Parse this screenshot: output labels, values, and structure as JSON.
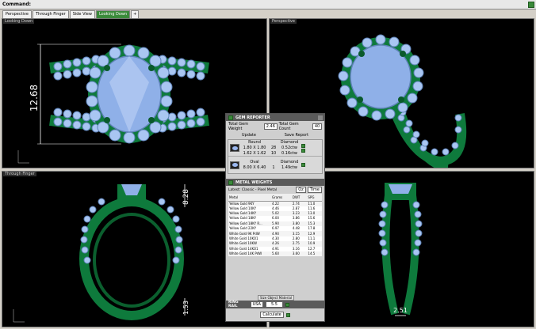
{
  "command": {
    "label": "Command:"
  },
  "tabs": [
    "Perspective",
    "Through Finger",
    "Side View",
    "Looking Down",
    "+"
  ],
  "viewports": {
    "top_left": {
      "caption": "Looking Down",
      "dimension": "12.68"
    },
    "top_right": {
      "caption": "Perspective"
    },
    "bottom_left": {
      "caption": "Through Finger",
      "dim_top": "8.28",
      "dim_bottom": "1.53"
    },
    "bottom_right": {
      "caption": "",
      "dimension": "2.51"
    }
  },
  "gem_reporter": {
    "title": "GEM REPORTER",
    "total_weight_label": "Total Gem Weight",
    "total_weight_value": "2.46",
    "total_count_label": "Total Gem Count",
    "total_count_value": "40",
    "update_label": "Update",
    "save_label": "Save Report",
    "gems": [
      {
        "shape": "Round",
        "type": "Diamond",
        "sizes": [
          "1.80 X 1.80",
          "1.62 X 1.62"
        ],
        "counts": [
          "28",
          "10"
        ],
        "weights": [
          "0.52ctw",
          "0.16ctw"
        ]
      },
      {
        "shape": "Oval",
        "type": "Diamond",
        "sizes": [
          "8.00 X 6.40"
        ],
        "counts": [
          "1"
        ],
        "weights": [
          "1.49ctw"
        ]
      }
    ]
  },
  "metal_weights": {
    "title": "METAL WEIGHTS",
    "subtitle": "Latest: Classic - Pixel Metal",
    "unit_select": "Oz",
    "extra_select": "Time",
    "columns": [
      "Metal",
      "Grams",
      "DWT",
      "SPG"
    ],
    "rows": [
      [
        "Yellow Gold 9KY",
        "4.22",
        "2.74",
        "11.0"
      ],
      [
        "Yellow Gold 10KY",
        "4.46",
        "2.87",
        "11.6"
      ],
      [
        "Yellow Gold 14KY",
        "5.02",
        "3.23",
        "13.0"
      ],
      [
        "Yellow Gold 18KY",
        "6.00",
        "3.86",
        "15.6"
      ],
      [
        "Yellow Gold 18KY R...",
        "5.90",
        "3.80",
        "15.3"
      ],
      [
        "Yellow Gold 22KY",
        "6.97",
        "4.48",
        "17.8"
      ],
      [
        "White Gold 9K PdW",
        "4.90",
        "3.15",
        "12.9"
      ],
      [
        "White Gold 10KO1",
        "4.30",
        "2.80",
        "11.1"
      ],
      [
        "White Gold 10KW",
        "4.26",
        "2.75",
        "10.9"
      ],
      [
        "White Gold 14KO1",
        "4.91",
        "3.16",
        "12.7"
      ],
      [
        "White Gold 14K PdW",
        "5.60",
        "3.60",
        "14.5"
      ]
    ],
    "object_button": "Size Object Material"
  },
  "ring_rail": {
    "label_top": "RING",
    "label_bottom": "RAIL",
    "region": "USA",
    "size": "5.5",
    "calculate": "Calculate"
  }
}
